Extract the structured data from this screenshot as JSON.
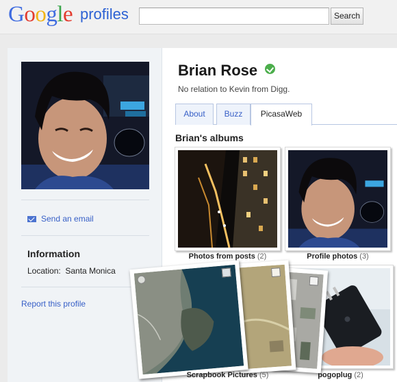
{
  "header": {
    "logo_letters": [
      "G",
      "o",
      "o",
      "g",
      "l",
      "e"
    ],
    "product": "profiles",
    "search_placeholder": "",
    "search_button": "Search"
  },
  "sidebar": {
    "send_email": "Send an email",
    "info_title": "Information",
    "location_label": "Location:",
    "location_value": "Santa Monica",
    "report": "Report this profile"
  },
  "profile": {
    "name": "Brian Rose",
    "tagline": "No relation to Kevin from Digg."
  },
  "tabs": [
    {
      "label": "About"
    },
    {
      "label": "Buzz"
    },
    {
      "label": "PicasaWeb",
      "active": true
    }
  ],
  "albums": {
    "title": "Brian's albums",
    "items": [
      {
        "name": "Photos from posts",
        "count": "(2)"
      },
      {
        "name": "Profile photos",
        "count": "(3)"
      },
      {
        "name": "Scrapbook Pictures",
        "count": "(5)"
      },
      {
        "name": "pogoplug",
        "count": "(2)"
      }
    ]
  },
  "colors": {
    "link": "#3860c7",
    "verified": "#4cae4c",
    "tab_border": "#b7c6e2"
  }
}
